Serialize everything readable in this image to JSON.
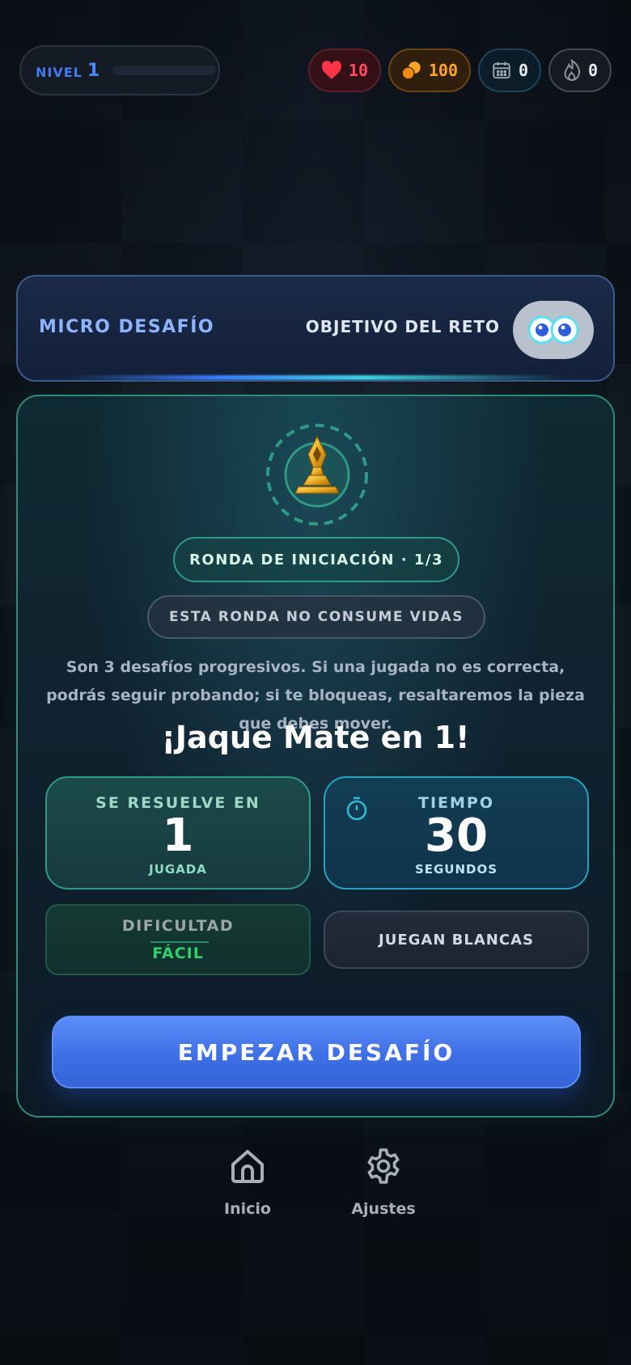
{
  "topbar": {
    "level_word": "NIVEL",
    "level_number": "1",
    "level_progress": 0.0,
    "hearts": "10",
    "coins": "100",
    "calendar": "0",
    "streak": "0",
    "colors": {
      "hearts": "#ff4d5e",
      "coins": "#ffa526",
      "level": "#4a88ff"
    }
  },
  "header": {
    "title": "MICRO DESAFÍO",
    "objective": "OBJETIVO DEL RETO",
    "objective_icon": "eyes-icon"
  },
  "challenge": {
    "emblem_icon": "bishop-trophy-icon",
    "round_label": "RONDA DE INICIACIÓN · 1/3",
    "lives_label": "ESTA RONDA NO CONSUME VIDAS",
    "description": "Son 3 desafíos progresivos. Si una jugada no es correcta, podrás seguir probando; si te bloqueas, resaltaremos la pieza que debes mover.",
    "title": "¡Jaque Mate en 1!",
    "moves": {
      "label": "SE RESUELVE EN",
      "value": "1",
      "unit": "JUGADA"
    },
    "time": {
      "label": "TIEMPO",
      "value": "30",
      "unit": "SEGUNDOS",
      "icon": "stopwatch-icon"
    },
    "difficulty": {
      "label": "DIFICULTAD",
      "value": "FÁCIL",
      "color": "#2fd06c"
    },
    "side": "JUEGAN BLANCAS",
    "start_button": "EMPEZAR DESAFÍO"
  },
  "nav": {
    "items": [
      {
        "label": "Inicio",
        "icon": "home-icon"
      },
      {
        "label": "Ajustes",
        "icon": "gear-icon"
      }
    ]
  }
}
